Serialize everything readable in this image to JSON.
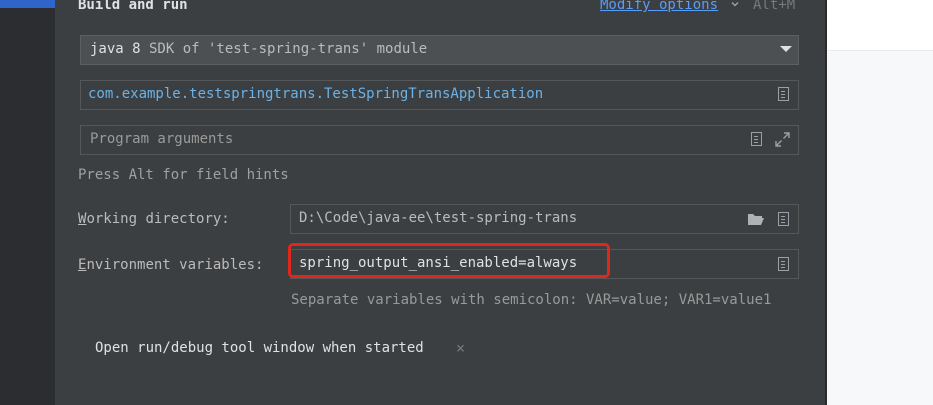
{
  "header": {
    "title": "Build and run",
    "modify_options": "Modify options",
    "shortcut": "Alt+M"
  },
  "sdk": {
    "name": "java 8",
    "detail": " SDK of 'test-spring-trans' module"
  },
  "main_class": {
    "value": "com.example.testspringtrans.TestSpringTransApplication"
  },
  "program_arguments": {
    "placeholder": "Program arguments"
  },
  "field_hint": "Press Alt for field hints",
  "working_directory": {
    "label_first": "W",
    "label_rest": "orking directory:",
    "value": "D:\\Code\\java-ee\\test-spring-trans"
  },
  "environment_variables": {
    "label_first": "E",
    "label_rest": "nvironment variables:",
    "value": "spring_output_ansi_enabled=always",
    "hint": "Separate variables with semicolon: VAR=value; VAR1=value1"
  },
  "option_tag": {
    "label": "Open run/debug tool window when started",
    "close": "×"
  },
  "colors": {
    "accent_link": "#589df6",
    "highlight": "#e0271d",
    "class_text": "#6bb2e6"
  },
  "icons": [
    "chevron-down-icon",
    "dropdown-arrow-icon",
    "document-icon",
    "expand-icon",
    "folder-icon",
    "close-icon"
  ]
}
